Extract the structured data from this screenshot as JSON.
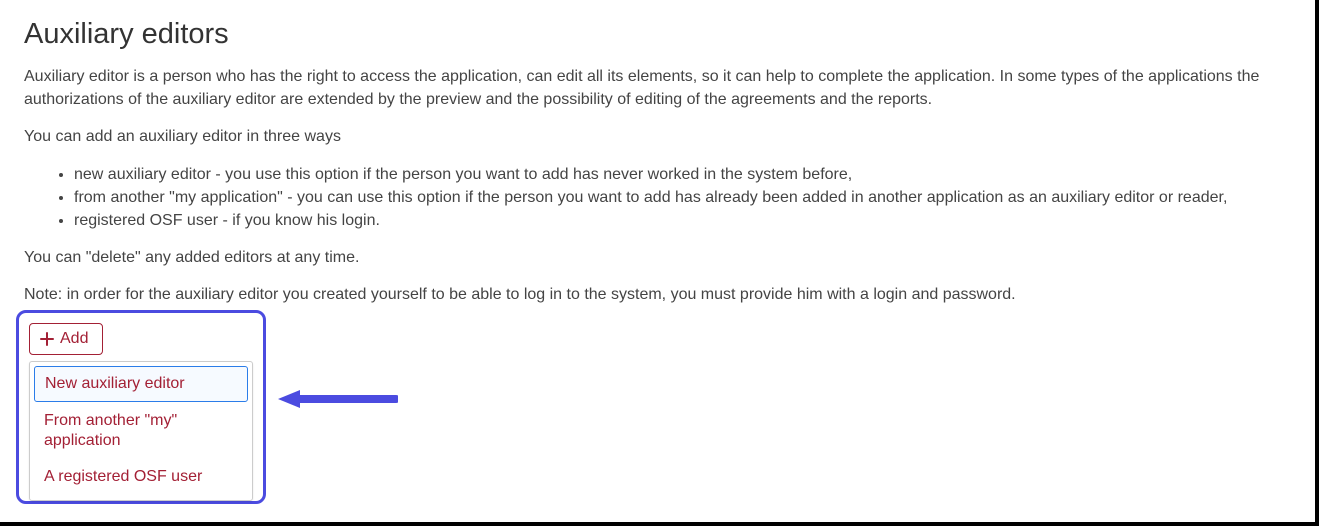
{
  "heading": "Auxiliary editors",
  "paragraph1": "Auxiliary editor is a person who has the right to access the application, can edit all its elements, so it can help to complete the application. In some types of the applications the authorizations of the auxiliary editor are extended by the preview and the possibility of editing of the agreements and the reports.",
  "paragraph2": "You can add an auxiliary editor in three ways",
  "bullets": [
    "new auxiliary editor - you use this option if the person you want to add has never worked in the system before,",
    "from another \"my application\" - you can use this option if the person you want to add has already been added in another application as an auxiliary editor or reader,",
    "registered OSF user - if you know his login."
  ],
  "paragraph3": "You can \"delete\" any added editors at any time.",
  "paragraph4": "Note: in order for the auxiliary editor you created yourself to be able to log in to the system, you must provide him with a login and password.",
  "addButton": "Add",
  "menu": {
    "item1": "New auxiliary editor",
    "item2": "From another \"my\" application",
    "item3": "A registered OSF user"
  },
  "colors": {
    "brand": "#a32035",
    "highlight": "#4b4be0"
  }
}
